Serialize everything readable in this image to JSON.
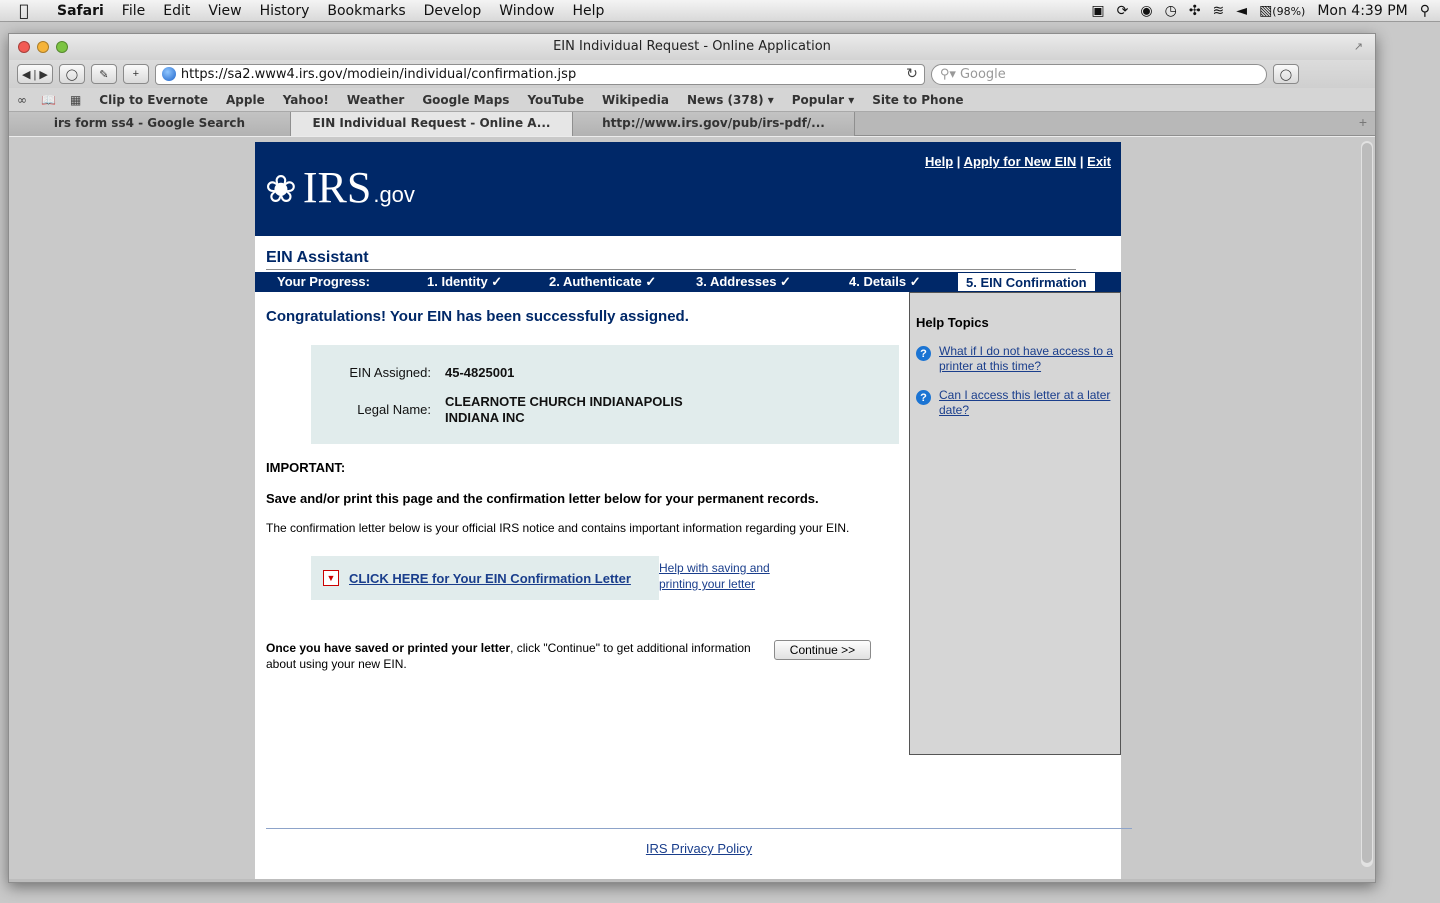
{
  "menubar": {
    "apple": "",
    "items": [
      "Safari",
      "File",
      "Edit",
      "View",
      "History",
      "Bookmarks",
      "Develop",
      "Window",
      "Help"
    ],
    "battery": "(98%)",
    "clock": "Mon 4:39 PM"
  },
  "window": {
    "title": "EIN Individual Request - Online Application"
  },
  "toolbar": {
    "url": "https://sa2.www4.irs.gov/modiein/individual/confirmation.jsp",
    "search_placeholder": "Google"
  },
  "bookmarks": [
    "Clip to Evernote",
    "Apple",
    "Yahoo!",
    "Weather",
    "Google Maps",
    "YouTube",
    "Wikipedia",
    "News (378) ▾",
    "Popular ▾",
    "Site to Phone"
  ],
  "tabs": [
    {
      "label": "irs form ss4 - Google Search"
    },
    {
      "label": "EIN Individual Request - Online A..."
    },
    {
      "label": "http://www.irs.gov/pub/irs-pdf/..."
    }
  ],
  "irs": {
    "logo_text": "IRS",
    "logo_suffix": ".gov",
    "links": {
      "help": "Help",
      "apply": "Apply for New EIN",
      "exit": "Exit",
      "sep": "|"
    },
    "assistant_title": "EIN Assistant",
    "progress": {
      "label": "Your Progress:",
      "steps": [
        "1. Identity ✓",
        "2. Authenticate ✓",
        "3. Addresses ✓",
        "4. Details ✓",
        "5. EIN Confirmation"
      ]
    },
    "congrats": "Congratulations! Your EIN has been successfully assigned.",
    "ein_label": "EIN Assigned:",
    "ein_value": "45-4825001",
    "legal_label": "Legal Name:",
    "legal_line1": "CLEARNOTE CHURCH INDIANAPOLIS",
    "legal_line2": "INDIANA INC",
    "important": "IMPORTANT:",
    "save_text": "Save and/or print this page and the confirmation letter below for your permanent records.",
    "official_text": "The confirmation letter below is your official IRS notice and contains important information regarding your EIN.",
    "letter_link": "CLICK HERE for Your EIN Confirmation Letter",
    "help_saving": "Help with saving and printing your letter",
    "continue_bold": "Once you have saved or printed your letter",
    "continue_rest": ", click \"Continue\" to get additional information about using your new EIN.",
    "continue_button": "Continue >>",
    "help_topics_title": "Help Topics",
    "help_topics": [
      "What if I do not have access to a printer at this time?",
      "Can I access this letter at a later date?"
    ],
    "privacy": "IRS Privacy Policy"
  }
}
